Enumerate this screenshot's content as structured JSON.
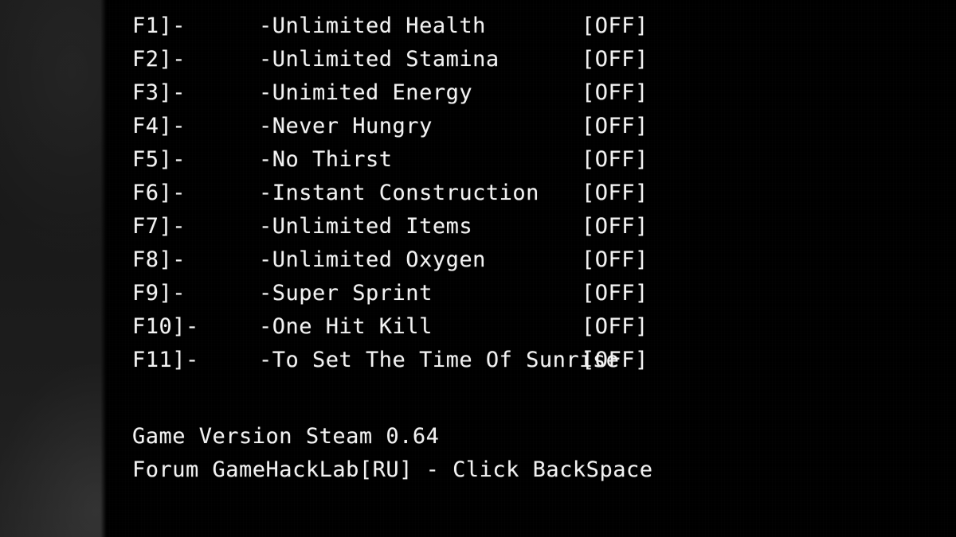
{
  "overlay": {
    "background_color": "#000000",
    "text_color": "#f2f2f2",
    "side_band_color": "#1b1b1b"
  },
  "cheats": {
    "rows": [
      {
        "key": "F1]-",
        "desc": "-Unlimited Health",
        "state": "[OFF]"
      },
      {
        "key": "F2]-",
        "desc": "-Unlimited Stamina",
        "state": "[OFF]"
      },
      {
        "key": "F3]-",
        "desc": "-Unimited Energy",
        "state": "[OFF]"
      },
      {
        "key": "F4]-",
        "desc": "-Never Hungry",
        "state": "[OFF]"
      },
      {
        "key": "F5]-",
        "desc": "-No Thirst",
        "state": "[OFF]"
      },
      {
        "key": "F6]-",
        "desc": "-Instant Construction",
        "state": "[OFF]"
      },
      {
        "key": "F7]-",
        "desc": "-Unlimited Items",
        "state": "[OFF]"
      },
      {
        "key": "F8]-",
        "desc": "-Unlimited Oxygen",
        "state": "[OFF]"
      },
      {
        "key": "F9]-",
        "desc": "-Super Sprint",
        "state": "[OFF]"
      },
      {
        "key": "F10]-",
        "desc": "-One Hit Kill",
        "state": "[OFF]"
      },
      {
        "key": "F11]-",
        "desc": "-To Set The Time Of Sunrise",
        "state": "[OFF]"
      }
    ]
  },
  "footer": {
    "game_version": "Game Version Steam 0.64",
    "forum_line": "Forum GameHackLab[RU] - Click BackSpace"
  }
}
